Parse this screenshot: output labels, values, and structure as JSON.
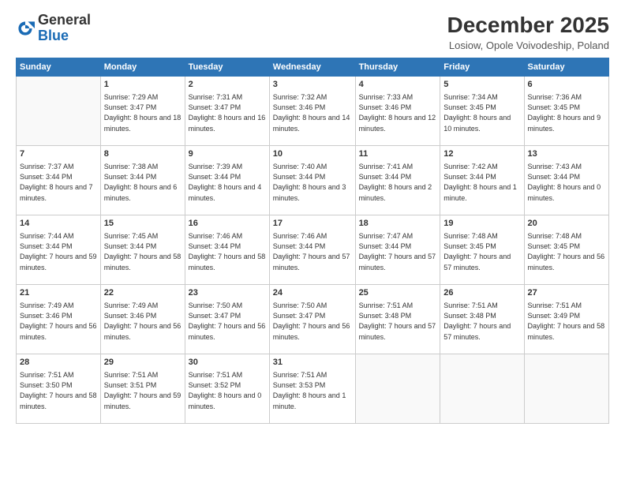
{
  "header": {
    "logo": {
      "line1": "General",
      "line2": "Blue"
    },
    "title": "December 2025",
    "location": "Losiow, Opole Voivodeship, Poland"
  },
  "days_of_week": [
    "Sunday",
    "Monday",
    "Tuesday",
    "Wednesday",
    "Thursday",
    "Friday",
    "Saturday"
  ],
  "weeks": [
    [
      {
        "day": "",
        "empty": true
      },
      {
        "day": "1",
        "sunrise": "7:29 AM",
        "sunset": "3:47 PM",
        "daylight": "8 hours and 18 minutes."
      },
      {
        "day": "2",
        "sunrise": "7:31 AM",
        "sunset": "3:47 PM",
        "daylight": "8 hours and 16 minutes."
      },
      {
        "day": "3",
        "sunrise": "7:32 AM",
        "sunset": "3:46 PM",
        "daylight": "8 hours and 14 minutes."
      },
      {
        "day": "4",
        "sunrise": "7:33 AM",
        "sunset": "3:46 PM",
        "daylight": "8 hours and 12 minutes."
      },
      {
        "day": "5",
        "sunrise": "7:34 AM",
        "sunset": "3:45 PM",
        "daylight": "8 hours and 10 minutes."
      },
      {
        "day": "6",
        "sunrise": "7:36 AM",
        "sunset": "3:45 PM",
        "daylight": "8 hours and 9 minutes."
      }
    ],
    [
      {
        "day": "7",
        "sunrise": "7:37 AM",
        "sunset": "3:44 PM",
        "daylight": "8 hours and 7 minutes."
      },
      {
        "day": "8",
        "sunrise": "7:38 AM",
        "sunset": "3:44 PM",
        "daylight": "8 hours and 6 minutes."
      },
      {
        "day": "9",
        "sunrise": "7:39 AM",
        "sunset": "3:44 PM",
        "daylight": "8 hours and 4 minutes."
      },
      {
        "day": "10",
        "sunrise": "7:40 AM",
        "sunset": "3:44 PM",
        "daylight": "8 hours and 3 minutes."
      },
      {
        "day": "11",
        "sunrise": "7:41 AM",
        "sunset": "3:44 PM",
        "daylight": "8 hours and 2 minutes."
      },
      {
        "day": "12",
        "sunrise": "7:42 AM",
        "sunset": "3:44 PM",
        "daylight": "8 hours and 1 minute."
      },
      {
        "day": "13",
        "sunrise": "7:43 AM",
        "sunset": "3:44 PM",
        "daylight": "8 hours and 0 minutes."
      }
    ],
    [
      {
        "day": "14",
        "sunrise": "7:44 AM",
        "sunset": "3:44 PM",
        "daylight": "7 hours and 59 minutes."
      },
      {
        "day": "15",
        "sunrise": "7:45 AM",
        "sunset": "3:44 PM",
        "daylight": "7 hours and 58 minutes."
      },
      {
        "day": "16",
        "sunrise": "7:46 AM",
        "sunset": "3:44 PM",
        "daylight": "7 hours and 58 minutes."
      },
      {
        "day": "17",
        "sunrise": "7:46 AM",
        "sunset": "3:44 PM",
        "daylight": "7 hours and 57 minutes."
      },
      {
        "day": "18",
        "sunrise": "7:47 AM",
        "sunset": "3:44 PM",
        "daylight": "7 hours and 57 minutes."
      },
      {
        "day": "19",
        "sunrise": "7:48 AM",
        "sunset": "3:45 PM",
        "daylight": "7 hours and 57 minutes."
      },
      {
        "day": "20",
        "sunrise": "7:48 AM",
        "sunset": "3:45 PM",
        "daylight": "7 hours and 56 minutes."
      }
    ],
    [
      {
        "day": "21",
        "sunrise": "7:49 AM",
        "sunset": "3:46 PM",
        "daylight": "7 hours and 56 minutes."
      },
      {
        "day": "22",
        "sunrise": "7:49 AM",
        "sunset": "3:46 PM",
        "daylight": "7 hours and 56 minutes."
      },
      {
        "day": "23",
        "sunrise": "7:50 AM",
        "sunset": "3:47 PM",
        "daylight": "7 hours and 56 minutes."
      },
      {
        "day": "24",
        "sunrise": "7:50 AM",
        "sunset": "3:47 PM",
        "daylight": "7 hours and 56 minutes."
      },
      {
        "day": "25",
        "sunrise": "7:51 AM",
        "sunset": "3:48 PM",
        "daylight": "7 hours and 57 minutes."
      },
      {
        "day": "26",
        "sunrise": "7:51 AM",
        "sunset": "3:48 PM",
        "daylight": "7 hours and 57 minutes."
      },
      {
        "day": "27",
        "sunrise": "7:51 AM",
        "sunset": "3:49 PM",
        "daylight": "7 hours and 58 minutes."
      }
    ],
    [
      {
        "day": "28",
        "sunrise": "7:51 AM",
        "sunset": "3:50 PM",
        "daylight": "7 hours and 58 minutes."
      },
      {
        "day": "29",
        "sunrise": "7:51 AM",
        "sunset": "3:51 PM",
        "daylight": "7 hours and 59 minutes."
      },
      {
        "day": "30",
        "sunrise": "7:51 AM",
        "sunset": "3:52 PM",
        "daylight": "8 hours and 0 minutes."
      },
      {
        "day": "31",
        "sunrise": "7:51 AM",
        "sunset": "3:53 PM",
        "daylight": "8 hours and 1 minute."
      },
      {
        "day": "",
        "empty": true
      },
      {
        "day": "",
        "empty": true
      },
      {
        "day": "",
        "empty": true
      }
    ]
  ],
  "labels": {
    "sunrise_prefix": "Sunrise: ",
    "sunset_prefix": "Sunset: ",
    "daylight_prefix": "Daylight: "
  }
}
